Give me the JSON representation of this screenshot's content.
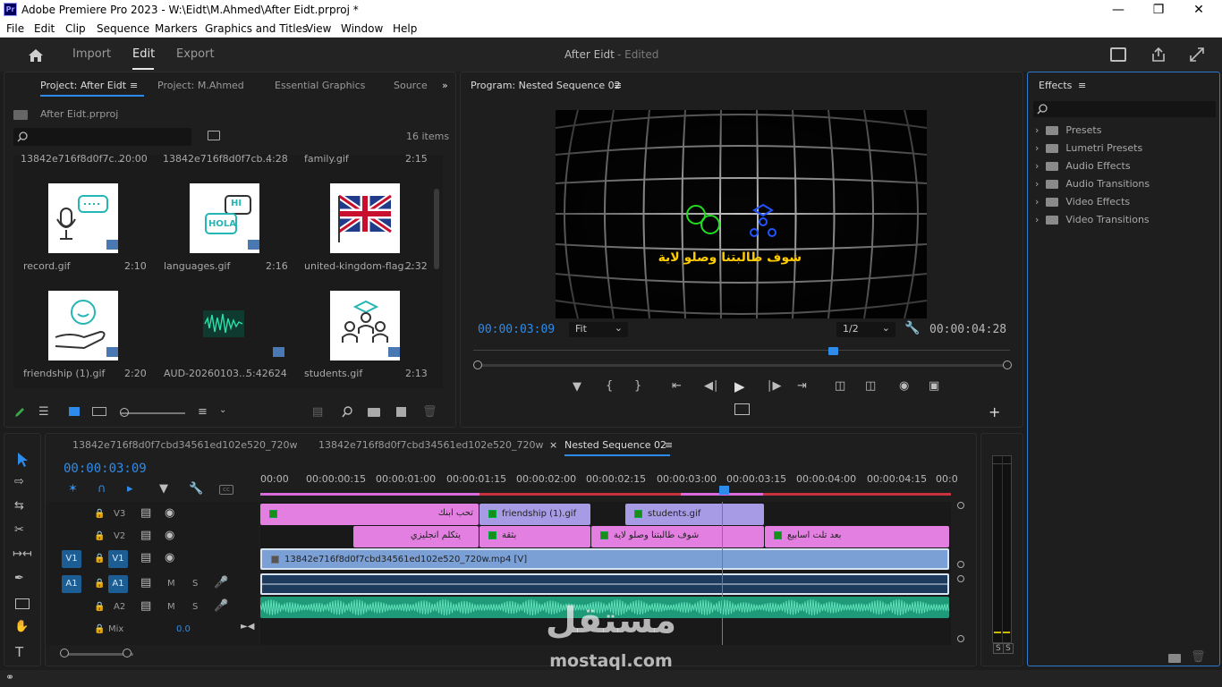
{
  "window": {
    "title": "Adobe Premiere Pro 2023 - W:\\Eidt\\M.Ahmed\\After Eidt.prproj *",
    "app_icon": "Pr"
  },
  "menu": [
    "File",
    "Edit",
    "Clip",
    "Sequence",
    "Markers",
    "Graphics and Titles",
    "View",
    "Window",
    "Help"
  ],
  "header": {
    "tabs": [
      "Import",
      "Edit",
      "Export"
    ],
    "active_tab": "Edit",
    "project_name": "After Eidt",
    "project_status": "- Edited"
  },
  "project_panel": {
    "tabs": [
      "Project: After Eidt",
      "Project: M.Ahmed",
      "Essential Graphics",
      "Source"
    ],
    "file": "After Eidt.prproj",
    "items_count": "16 items",
    "search_placeholder": "",
    "top_row": [
      {
        "name": "13842e716f8d0f7c...",
        "duration": "20:00"
      },
      {
        "name": "13842e716f8d0f7cb...",
        "duration": "4:28"
      },
      {
        "name": "family.gif",
        "duration": "2:15"
      }
    ],
    "items": [
      {
        "name": "record.gif",
        "duration": "2:10"
      },
      {
        "name": "languages.gif",
        "duration": "2:16"
      },
      {
        "name": "united-kingdom-flag...",
        "duration": "2:32"
      },
      {
        "name": "friendship (1).gif",
        "duration": "2:20"
      },
      {
        "name": "AUD-20260103...",
        "duration": "5:42624"
      },
      {
        "name": "students.gif",
        "duration": "2:13"
      }
    ],
    "thumb_text": {
      "hi": "HI",
      "hola": "HOLA"
    }
  },
  "program": {
    "tab": "Program: Nested Sequence 02",
    "timecode": "00:00:03:09",
    "fit": "Fit",
    "resolution": "1/2",
    "duration": "00:00:04:28",
    "overlay_text": "شوف طالبتنا وصلو لاية",
    "playhead_fraction": 0.67
  },
  "effects": {
    "title": "Effects",
    "items": [
      "Presets",
      "Lumetri Presets",
      "Audio Effects",
      "Audio Transitions",
      "Video Effects",
      "Video Transitions"
    ]
  },
  "timeline": {
    "tabs": [
      "13842e716f8d0f7cbd34561ed102e520_720w",
      "13842e716f8d0f7cbd34561ed102e520_720w",
      "Nested Sequence 02"
    ],
    "timecode": "00:00:03:09",
    "ruler": [
      "00:00",
      "00:00:00:15",
      "00:00:01:00",
      "00:00:01:15",
      "00:00:02:00",
      "00:00:02:15",
      "00:00:03:00",
      "00:00:03:15",
      "00:00:04:00",
      "00:00:04:15",
      "00:0"
    ],
    "tracks": {
      "v3": "V3",
      "v2": "V2",
      "v1": "V1",
      "a1": "A1",
      "a2": "A2",
      "src_v1": "V1",
      "src_a1": "A1",
      "mix": "Mix",
      "mix_value": "0.0",
      "mute": "M",
      "solo": "S"
    },
    "clips": {
      "v3": [
        "تحب ابنك",
        "friendship (1).gif",
        "students.gif"
      ],
      "v2": [
        "يتكلم انجليزي",
        "بثقة",
        "شوف طالبتنا وصلو لاية",
        "بعد تلت اسابيع"
      ],
      "v1": "13842e716f8d0f7cbd34561ed102e520_720w.mp4 [V]"
    }
  },
  "meter": {
    "labels": [
      "S",
      "S"
    ]
  },
  "watermark": {
    "logo": "مستقل",
    "url": "mostaql.com"
  },
  "colors": {
    "accent_blue": "#2d8ceb",
    "clip_pink": "#e27fe0",
    "clip_purple": "#a79be6",
    "clip_blue": "#7aa0d6",
    "audio_green": "#1e9a78",
    "timecode_blue": "#2d8ceb"
  }
}
